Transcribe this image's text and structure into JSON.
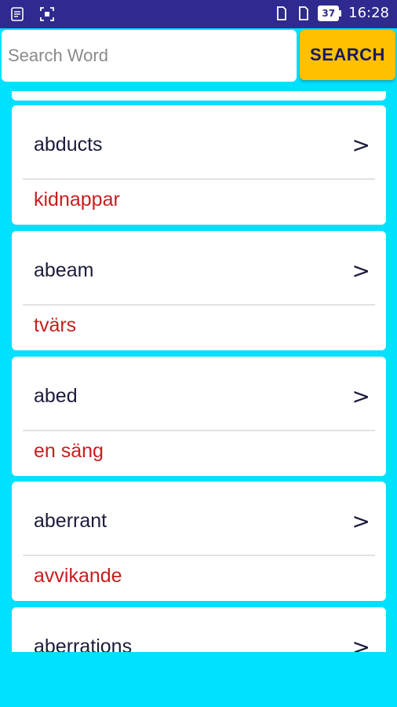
{
  "status_bar": {
    "left_icons": [
      "notes-icon",
      "screenshot-icon"
    ],
    "right_icons": [
      "sim-card-icon",
      "sim-card-icon"
    ],
    "battery": "37",
    "time": "16:28"
  },
  "search": {
    "placeholder": "Search Word",
    "value": "",
    "button_label": "SEARCH"
  },
  "entries": [
    {
      "word": "abducts",
      "translation": "kidnappar",
      "chevron": ">"
    },
    {
      "word": "abeam",
      "translation": "tvärs",
      "chevron": ">"
    },
    {
      "word": "abed",
      "translation": "en säng",
      "chevron": ">"
    },
    {
      "word": "aberrant",
      "translation": "avvikande",
      "chevron": ">"
    },
    {
      "word": "aberrations",
      "translation": "",
      "chevron": ">"
    }
  ],
  "colors": {
    "background": "#00e0ff",
    "status_bar": "#2f2a8f",
    "search_button": "#ffc000",
    "translation_text": "#c81e1e"
  }
}
